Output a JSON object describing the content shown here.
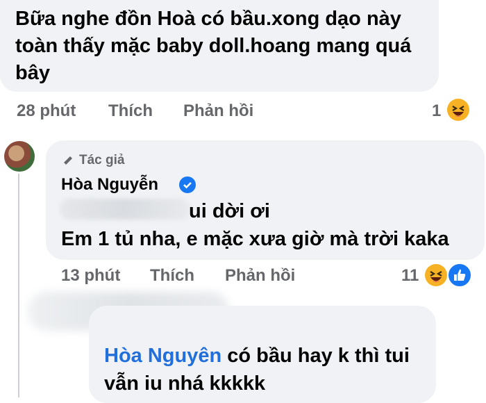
{
  "comment1": {
    "text": "Bữa nghe đồn Hoà có bầu.xong dạo này toàn thấy mặc baby doll.hoang mang quá bây",
    "time": "28 phút",
    "like_label": "Thích",
    "reply_label": "Phản hồi",
    "reaction_count": "1",
    "reaction_icons": [
      "haha-icon"
    ]
  },
  "reply": {
    "author_badge": "Tác giả",
    "author_name": "Hòa Nguyễn",
    "line1": "ui dời ơi",
    "line2": "Em 1 tủ nha, e mặc xưa giờ mà trời kaka",
    "time": "13 phút",
    "like_label": "Thích",
    "reply_label": "Phản hồi",
    "reaction_count": "11",
    "reaction_icons": [
      "haha-icon",
      "like-icon"
    ]
  },
  "comment2": {
    "mention": "Hòa Nguyên",
    "line1_rest": " có bầu hay k thì tui",
    "line2": "vẫn iu nhá kkkkk"
  },
  "colors": {
    "bubble": "#f0f2f5",
    "action_text": "#65676b",
    "mention": "#216fdb",
    "verified": "#1877f2"
  }
}
